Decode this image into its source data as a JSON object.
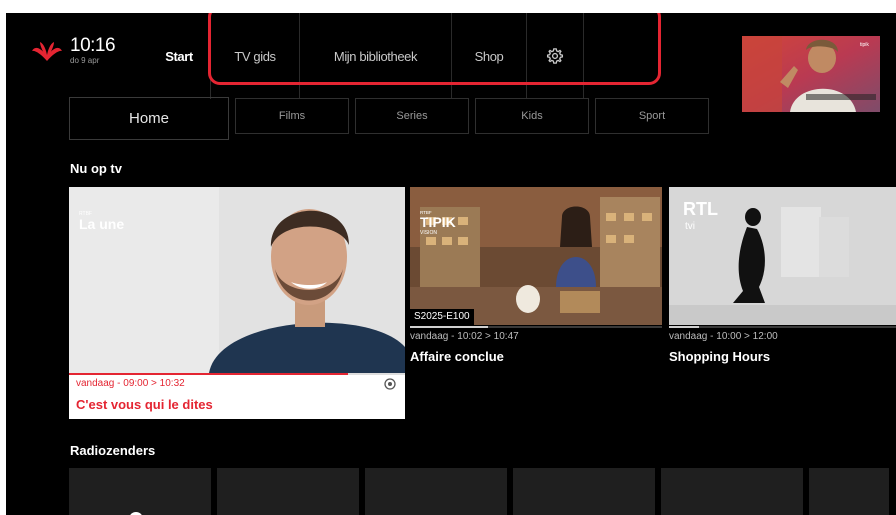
{
  "header": {
    "time": "10:16",
    "date": "do 9 apr",
    "nav": [
      {
        "label": "Start",
        "active": true
      },
      {
        "label": "TV gids",
        "active": false
      },
      {
        "label": "Mijn bibliotheek",
        "active": false
      },
      {
        "label": "Shop",
        "active": false
      }
    ],
    "settings_icon": "gear-icon",
    "logo_icon": "proximus-logo-icon",
    "highlight_color": "#e42532"
  },
  "subnav": {
    "tabs": [
      "Home",
      "Films",
      "Series",
      "Kids",
      "Sport"
    ]
  },
  "now_on_tv": {
    "title": "Nu op tv",
    "cards": [
      {
        "channel_logo": "La une",
        "channel_brand": "RTBF",
        "time": "vandaag - 09:00 > 10:32",
        "title": "C'est vous qui le dites",
        "progress": 0.83,
        "accent": "#e42532"
      },
      {
        "channel_logo": "TIPIK",
        "channel_sub": "VISION",
        "channel_brand": "RTBF",
        "episode": "S2025-E100",
        "time": "vandaag - 10:02 > 10:47",
        "title": "Affaire conclue",
        "progress": 0.31
      },
      {
        "channel_logo": "RTL",
        "channel_sub": "tvi",
        "time": "vandaag - 10:00 > 12:00",
        "title": "Shopping Hours",
        "progress": 0.13
      }
    ]
  },
  "radio": {
    "title": "Radiozenders"
  }
}
